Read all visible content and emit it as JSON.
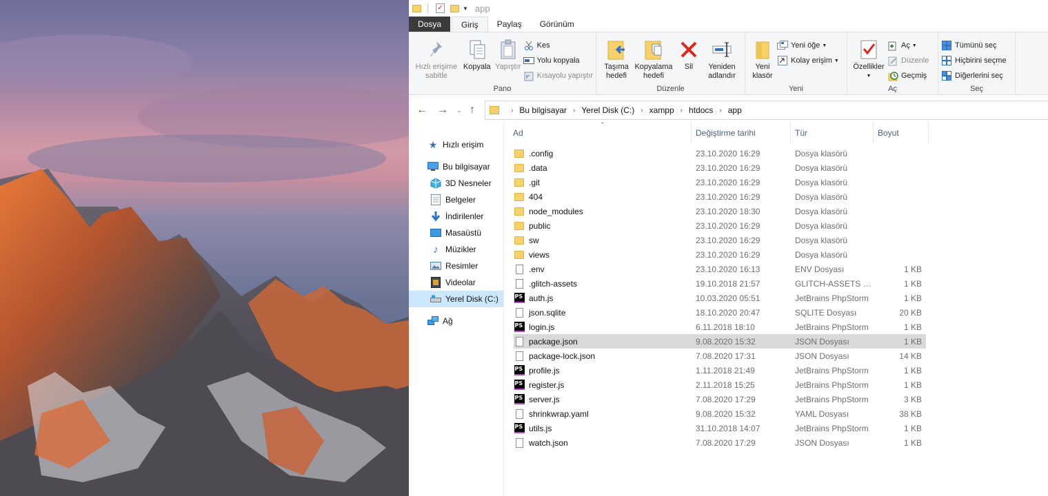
{
  "window": {
    "title": "app"
  },
  "tabs": [
    {
      "label": "Dosya"
    },
    {
      "label": "Giriş"
    },
    {
      "label": "Paylaş"
    },
    {
      "label": "Görünüm"
    }
  ],
  "ribbon": {
    "pano": {
      "label": "Pano",
      "pin": "Hızlı erişime sabitle",
      "copy": "Kopyala",
      "paste": "Yapıştır",
      "cut": "Kes",
      "copy_path": "Yolu kopyala",
      "paste_shortcut": "Kısayolu yapıştır"
    },
    "duzenle": {
      "label": "Düzenle",
      "move_to": "Taşıma hedefi",
      "copy_to": "Kopyalama hedefi",
      "delete": "Sil",
      "rename": "Yeniden adlandır"
    },
    "yeni": {
      "label": "Yeni",
      "new_folder": "Yeni klasör",
      "new_item": "Yeni öğe",
      "easy_access": "Kolay erişim"
    },
    "ac": {
      "label": "Aç",
      "properties": "Özellikler",
      "open": "Aç",
      "edit": "Düzenle",
      "history": "Geçmiş"
    },
    "sec": {
      "label": "Seç",
      "select_all": "Tümünü seç",
      "select_none": "Hiçbirini seçme",
      "invert": "Diğerlerini seç"
    }
  },
  "address": {
    "crumbs": [
      "Bu bilgisayar",
      "Yerel Disk (C:)",
      "xampp",
      "htdocs",
      "app"
    ]
  },
  "nav": {
    "quick_access": "Hızlı erişim",
    "this_pc": "Bu bilgisayar",
    "items": [
      {
        "label": "3D Nesneler",
        "icon": "cube-icon"
      },
      {
        "label": "Belgeler",
        "icon": "documents-icon"
      },
      {
        "label": "İndirilenler",
        "icon": "download-icon"
      },
      {
        "label": "Masaüstü",
        "icon": "desktop-icon"
      },
      {
        "label": "Müzikler",
        "icon": "music-icon"
      },
      {
        "label": "Resimler",
        "icon": "pictures-icon"
      },
      {
        "label": "Videolar",
        "icon": "videos-icon"
      },
      {
        "label": "Yerel Disk (C:)",
        "icon": "drive-icon"
      }
    ],
    "network": "Ağ"
  },
  "columns": {
    "name": "Ad",
    "date": "Değiştirme tarihi",
    "type": "Tür",
    "size": "Boyut"
  },
  "files": [
    {
      "name": ".config",
      "date": "23.10.2020 16:29",
      "type": "Dosya klasörü",
      "size": "",
      "icon": "folder"
    },
    {
      "name": ".data",
      "date": "23.10.2020 16:29",
      "type": "Dosya klasörü",
      "size": "",
      "icon": "folder"
    },
    {
      "name": ".git",
      "date": "23.10.2020 16:29",
      "type": "Dosya klasörü",
      "size": "",
      "icon": "folder"
    },
    {
      "name": "404",
      "date": "23.10.2020 16:29",
      "type": "Dosya klasörü",
      "size": "",
      "icon": "folder"
    },
    {
      "name": "node_modules",
      "date": "23.10.2020 18:30",
      "type": "Dosya klasörü",
      "size": "",
      "icon": "folder"
    },
    {
      "name": "public",
      "date": "23.10.2020 16:29",
      "type": "Dosya klasörü",
      "size": "",
      "icon": "folder"
    },
    {
      "name": "sw",
      "date": "23.10.2020 16:29",
      "type": "Dosya klasörü",
      "size": "",
      "icon": "folder"
    },
    {
      "name": "views",
      "date": "23.10.2020 16:29",
      "type": "Dosya klasörü",
      "size": "",
      "icon": "folder"
    },
    {
      "name": ".env",
      "date": "23.10.2020 16:13",
      "type": "ENV Dosyası",
      "size": "1 KB",
      "icon": "doc"
    },
    {
      "name": ".glitch-assets",
      "date": "19.10.2018 21:57",
      "type": "GLITCH-ASSETS D...",
      "size": "1 KB",
      "icon": "doc"
    },
    {
      "name": "auth.js",
      "date": "10.03.2020 05:51",
      "type": "JetBrains PhpStorm",
      "size": "1 KB",
      "icon": "ps"
    },
    {
      "name": "json.sqlite",
      "date": "18.10.2020 20:47",
      "type": "SQLITE Dosyası",
      "size": "20 KB",
      "icon": "doc"
    },
    {
      "name": "login.js",
      "date": "6.11.2018 18:10",
      "type": "JetBrains PhpStorm",
      "size": "1 KB",
      "icon": "ps"
    },
    {
      "name": "package.json",
      "date": "9.08.2020 15:32",
      "type": "JSON Dosyası",
      "size": "1 KB",
      "icon": "doc",
      "selected": true
    },
    {
      "name": "package-lock.json",
      "date": "7.08.2020 17:31",
      "type": "JSON Dosyası",
      "size": "14 KB",
      "icon": "doc"
    },
    {
      "name": "profile.js",
      "date": "1.11.2018 21:49",
      "type": "JetBrains PhpStorm",
      "size": "1 KB",
      "icon": "ps"
    },
    {
      "name": "register.js",
      "date": "2.11.2018 15:25",
      "type": "JetBrains PhpStorm",
      "size": "1 KB",
      "icon": "ps"
    },
    {
      "name": "server.js",
      "date": "7.08.2020 17:29",
      "type": "JetBrains PhpStorm",
      "size": "3 KB",
      "icon": "ps"
    },
    {
      "name": "shrinkwrap.yaml",
      "date": "9.08.2020 15:32",
      "type": "YAML Dosyası",
      "size": "38 KB",
      "icon": "doc"
    },
    {
      "name": "utils.js",
      "date": "31.10.2018 14:07",
      "type": "JetBrains PhpStorm",
      "size": "1 KB",
      "icon": "ps"
    },
    {
      "name": "watch.json",
      "date": "7.08.2020 17:29",
      "type": "JSON Dosyası",
      "size": "1 KB",
      "icon": "doc"
    }
  ],
  "colors": {
    "selection": "#d9d9d9",
    "nav_selection": "#cce8ff",
    "file_tab": "#3b3b3b",
    "folder": "#f7d16a"
  }
}
